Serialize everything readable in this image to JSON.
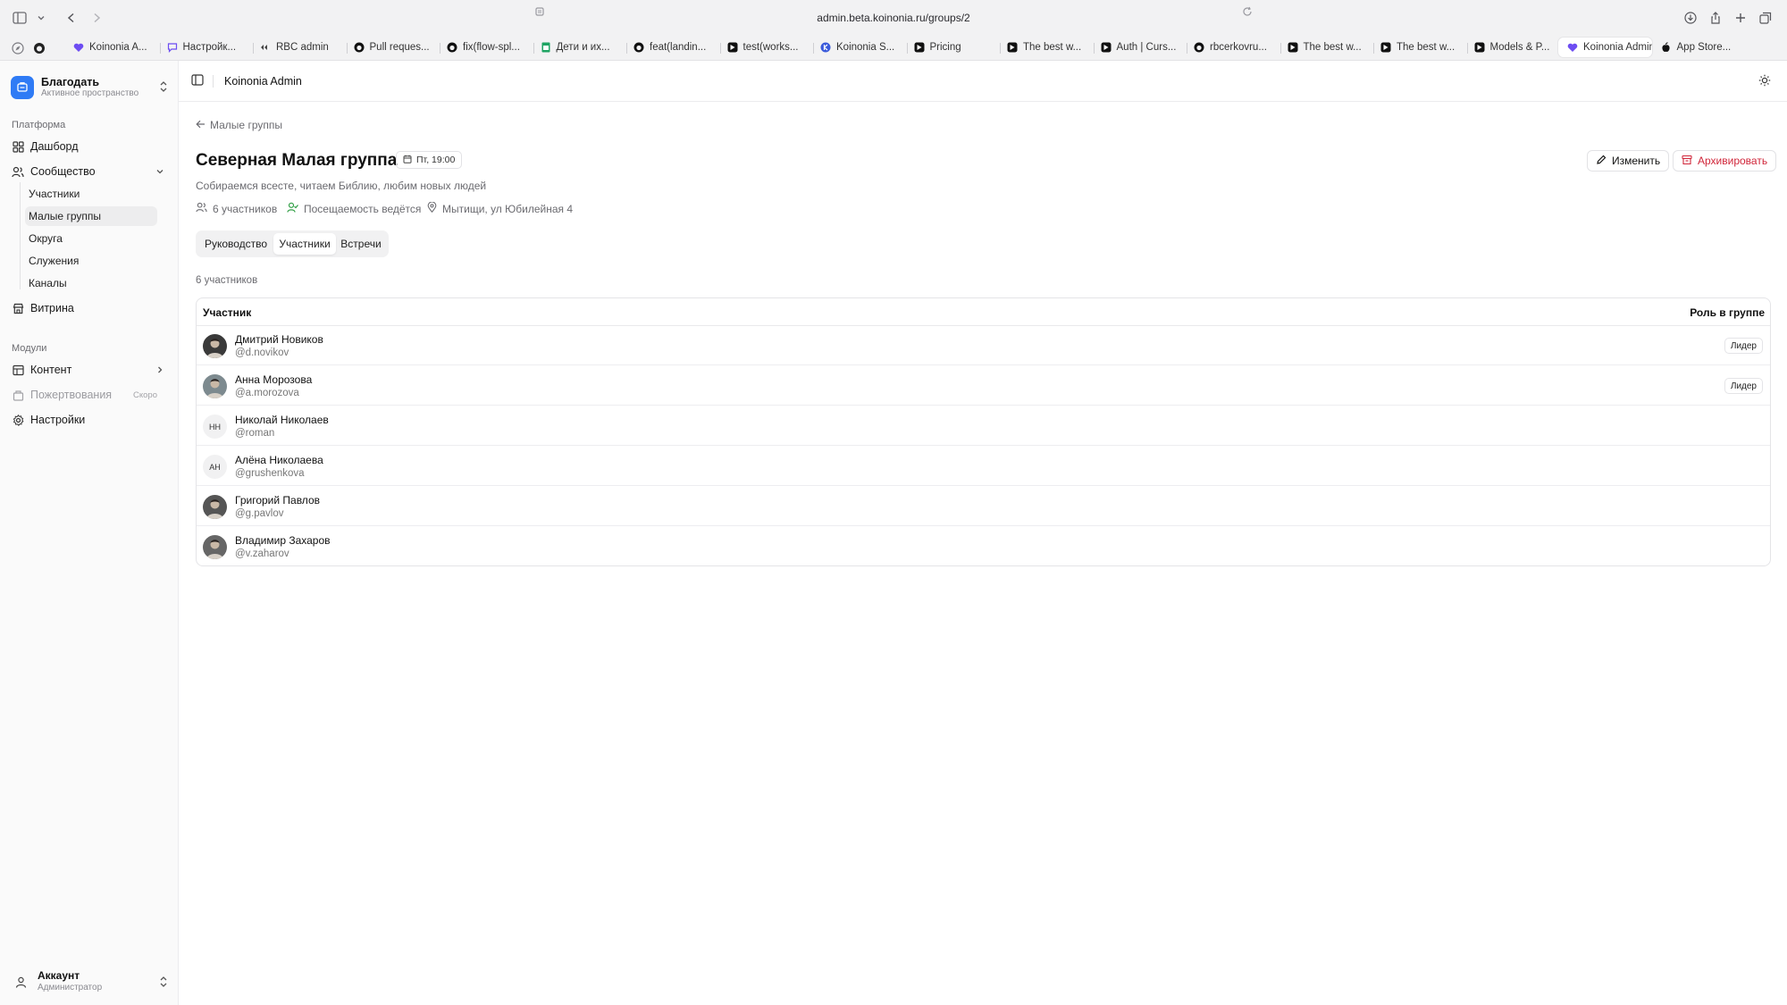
{
  "browser": {
    "url": "admin.beta.koinonia.ru/groups/2",
    "tabs": [
      {
        "label": "Koinonia A...",
        "icon": "koinonia-heart-icon",
        "color": "#6d4df2"
      },
      {
        "label": "Настройк...",
        "icon": "chat-icon",
        "color": "#6d4df2"
      },
      {
        "label": "RBC admin",
        "icon": "rbc-icon",
        "color": "#444444"
      },
      {
        "label": "Pull reques...",
        "icon": "github-icon",
        "color": "#111111"
      },
      {
        "label": "fix(flow-spl...",
        "icon": "github-icon",
        "color": "#111111"
      },
      {
        "label": "Дети и их...",
        "icon": "sheets-icon",
        "color": "#1fa463"
      },
      {
        "label": "feat(landin...",
        "icon": "github-icon",
        "color": "#111111"
      },
      {
        "label": "test(works...",
        "icon": "cursor-icon",
        "color": "#111111"
      },
      {
        "label": "Koinonia S...",
        "icon": "koinonia-k-icon",
        "color": "#3b5bdb"
      },
      {
        "label": "Pricing",
        "icon": "cursor-icon",
        "color": "#111111"
      },
      {
        "label": "The best w...",
        "icon": "cursor-icon",
        "color": "#111111"
      },
      {
        "label": "Auth | Curs...",
        "icon": "cursor-icon",
        "color": "#111111"
      },
      {
        "label": "rbcerkovru...",
        "icon": "github-icon",
        "color": "#111111"
      },
      {
        "label": "The best w...",
        "icon": "cursor-icon",
        "color": "#111111"
      },
      {
        "label": "The best w...",
        "icon": "cursor-icon",
        "color": "#111111"
      },
      {
        "label": "Models & P...",
        "icon": "cursor-icon",
        "color": "#111111"
      },
      {
        "label": "Koinonia Admin",
        "icon": "koinonia-heart-icon",
        "color": "#6d4df2",
        "active": true
      },
      {
        "label": "App Store...",
        "icon": "apple-icon",
        "color": "#111111"
      }
    ]
  },
  "sidebar": {
    "workspace": {
      "name": "Благодать",
      "subtitle": "Активное пространство",
      "color": "#2f7bf5"
    },
    "platform_label": "Платформа",
    "dashboard": "Дашборд",
    "community": "Сообщество",
    "community_items": [
      "Участники",
      "Малые группы",
      "Округа",
      "Служения",
      "Каналы"
    ],
    "showcase": "Витрина",
    "modules_label": "Модули",
    "content": "Контент",
    "donations": "Пожертвования",
    "donations_badge": "Скоро",
    "settings": "Настройки",
    "account": {
      "name": "Аккаунт",
      "role": "Администратор"
    }
  },
  "header": {
    "title": "Koinonia Admin"
  },
  "page": {
    "back_label": "Малые группы",
    "title": "Северная Малая группа",
    "time_badge": "Пт, 19:00",
    "description": "Собираемся всесте, читаем Библию, любим новых людей",
    "meta_members": "6 участников",
    "meta_attendance": "Посещаемость ведётся",
    "meta_location": "Мытищи, ул Юбилейная 4",
    "edit_button": "Изменить",
    "archive_button": "Архивировать",
    "tabs": [
      "Руководство",
      "Участники",
      "Встречи"
    ],
    "active_tab": "Участники",
    "members_count": "6 участников",
    "colors": {
      "danger": "#d0263a",
      "attendance": "#2f9e44"
    }
  },
  "table": {
    "col_member": "Участник",
    "col_role": "Роль в группе",
    "rows": [
      {
        "name": "Дмитрий Новиков",
        "handle": "@d.novikov",
        "role": "Лидер",
        "avatar": "photo"
      },
      {
        "name": "Анна Морозова",
        "handle": "@a.morozova",
        "role": "Лидер",
        "avatar": "photo"
      },
      {
        "name": "Николай Николаев",
        "handle": "@roman",
        "role": "",
        "avatar": "НН"
      },
      {
        "name": "Алёна Николаева",
        "handle": "@grushenkova",
        "role": "",
        "avatar": "АН"
      },
      {
        "name": "Григорий Павлов",
        "handle": "@g.pavlov",
        "role": "",
        "avatar": "photo"
      },
      {
        "name": "Владимир Захаров",
        "handle": "@v.zaharov",
        "role": "",
        "avatar": "photo"
      }
    ]
  }
}
